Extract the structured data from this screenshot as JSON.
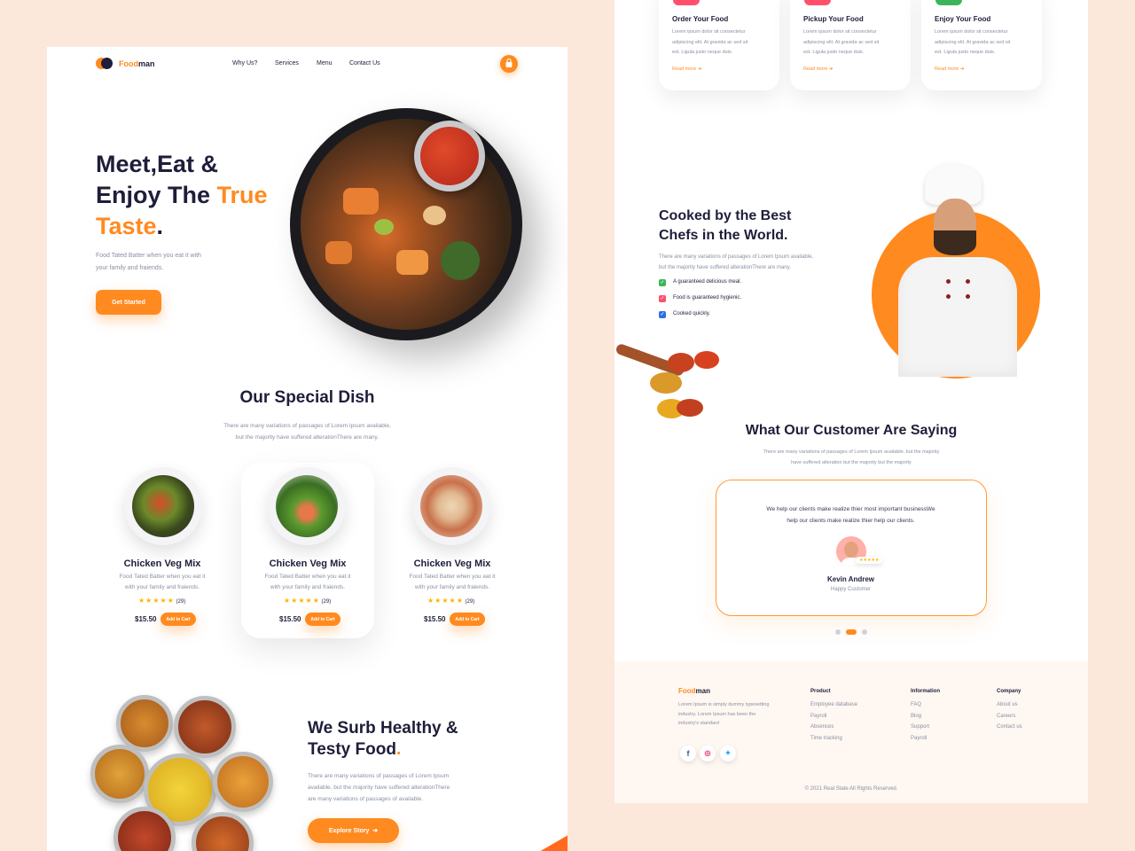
{
  "brand": {
    "logo_a": "Food",
    "logo_b": "man"
  },
  "nav": {
    "items": [
      "Why Us?",
      "Services",
      "Menu",
      "Contact Us"
    ]
  },
  "hero": {
    "line1": "Meet,Eat &",
    "line2a": "Enjoy The ",
    "line2b": "True",
    "line3a": "Taste",
    "line3b": ".",
    "desc1": "Food Tated Batter when you eat it with",
    "desc2": "your family and fraiends.",
    "cta": "Get Started"
  },
  "special": {
    "title": "Our Special Dish",
    "desc1": "There are many variations of passages of Lorem Ipsum available,",
    "desc2": "but the majority have suffered alterationThere are many.",
    "cards": [
      {
        "name": "Chicken Veg Mix",
        "desc1": "Food Tated Batter when you eat it",
        "desc2": "with your family and fraiends.",
        "stars": "★★★★★",
        "reviews": "(29)",
        "price": "$15.50",
        "btn": "Add to Cart"
      },
      {
        "name": "Chicken Veg Mix",
        "desc1": "Food Tated Batter when you eat it",
        "desc2": "with your family and fraiends.",
        "stars": "★★★★★",
        "reviews": "(29)",
        "price": "$15.50",
        "btn": "Add to Cart"
      },
      {
        "name": "Chicken Veg Mix",
        "desc1": "Food Tated Batter when you eat it",
        "desc2": "with your family and fraiends.",
        "stars": "★★★★★",
        "reviews": "(29)",
        "price": "$15.50",
        "btn": "Add to Cart"
      }
    ]
  },
  "healthy": {
    "title1": "We Surb Healthy &",
    "title2": "Testy Food",
    "dot": ".",
    "desc1": "There are many variations of passages of Lorem Ipsum",
    "desc2": "available, but the majority have suffered alterationThere",
    "desc3": "are many variations of passages of available.",
    "cta": "Explore Story"
  },
  "steps": [
    {
      "title": "Order Your Food",
      "desc1": "Lorem ipsum dolor sit consectetur",
      "desc2": "adipiscing elit. At gravida ac sed sit",
      "desc3": "est. Ligula justo neque duis.",
      "link": "Read more",
      "color": "#ff4f6d"
    },
    {
      "title": "Pickup Your Food",
      "desc1": "Lorem ipsum dolor sit consectetur",
      "desc2": "adipiscing elit. At gravida ac sed sit",
      "desc3": "est. Ligula justo neque duis.",
      "link": "Read more",
      "color": "#ff4f6d"
    },
    {
      "title": "Enjoy Your Food",
      "desc1": "Lorem ipsum dolor sit consectetur",
      "desc2": "adipiscing elit. At gravida ac sed sit",
      "desc3": "est. Ligula justo neque duis.",
      "link": "Read more",
      "color": "#3cb55a"
    }
  ],
  "chefs": {
    "title1": "Cooked by the Best",
    "title2": "Chefs in the World.",
    "desc1": "There are many variations of passages of Lorem Ipsum available,",
    "desc2": "but the majority have suffered alterationThere are many.",
    "checks": [
      {
        "text": "A guaranteed delicious meal.",
        "color": "#3cb55a"
      },
      {
        "text": "Food is guaranteed hygienic.",
        "color": "#ff4f6d"
      },
      {
        "text": "Cooked quickly.",
        "color": "#2f6fe4"
      }
    ]
  },
  "testimonials": {
    "title": "What Our Customer Are Saying",
    "desc1": "There are many variations of passages of Lorem Ipsum available, but the majority",
    "desc2": "have suffered alteration  but the majority  but the majority",
    "quote1": "We help our clients make realize thier most important businessWe",
    "quote2": "help our clients make realize thier help our clients.",
    "stars": "★★★★★",
    "name": "Kevin Andrew",
    "role": "Happy Customer"
  },
  "footer": {
    "brand_a": "Food",
    "brand_b": "man",
    "about1": "Lorem Ipsum is simply dummy typesetting",
    "about2": "industry. Lorem Ipsum has been the",
    "about3": "industry's standard",
    "product_head": "Product",
    "product": [
      "Employee database",
      "Payroll",
      "Absences",
      "Time tracking"
    ],
    "info_head": "Information",
    "info": [
      "FAQ",
      "Blog",
      "Support",
      "Payroll"
    ],
    "company_head": "Company",
    "company": [
      "About us",
      "Careers",
      "Contact us"
    ],
    "copyright": "© 2021 Real State All Rights Reserved."
  }
}
